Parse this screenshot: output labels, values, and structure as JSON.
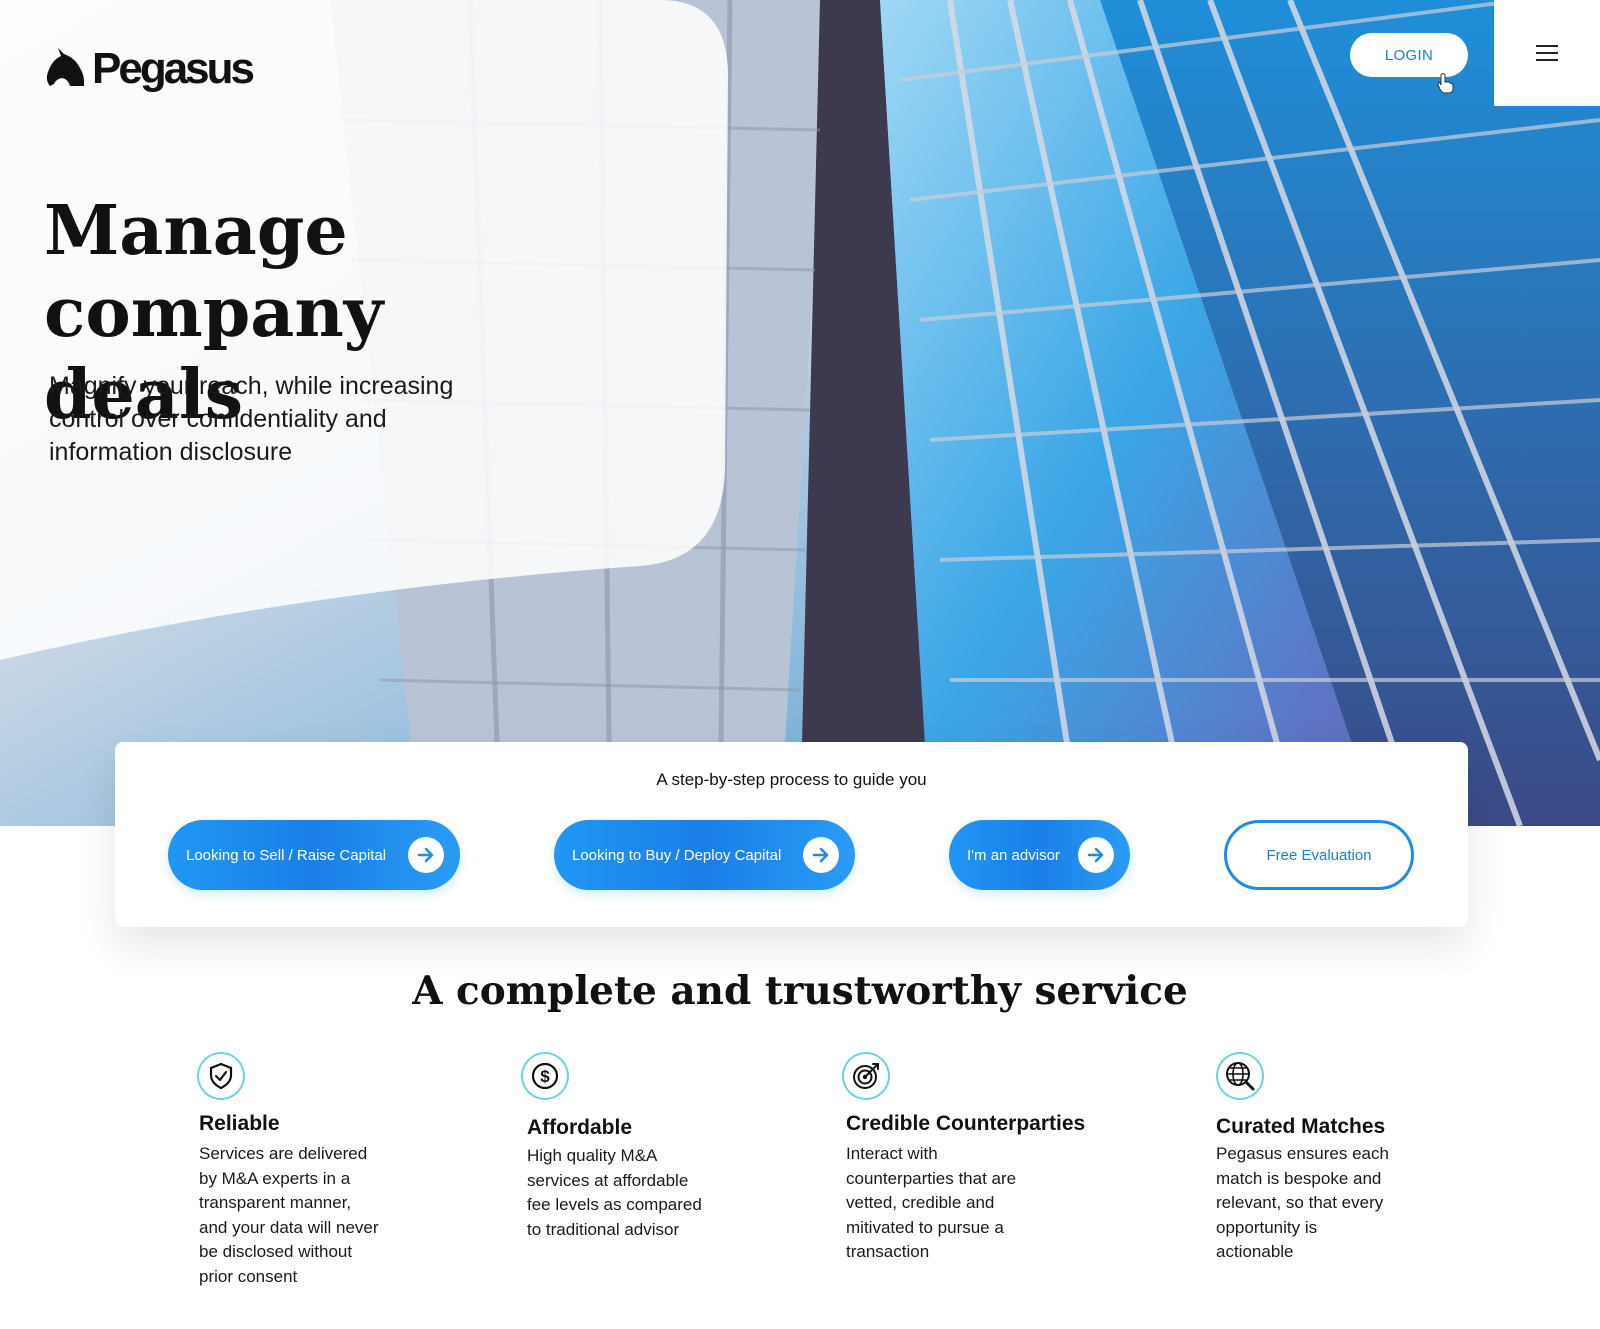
{
  "brand": {
    "name": "Pegasus"
  },
  "header": {
    "login_label": "LOGIN"
  },
  "hero": {
    "title_line1": "Manage",
    "title_line2": "company deals",
    "subtitle_line1": "Magnify your reach, while increasing",
    "subtitle_line2": "control over confidentiality and",
    "subtitle_line3": "information disclosure"
  },
  "process": {
    "title": "A step-by-step process to guide you",
    "buttons": [
      {
        "label": "Looking to Sell / Raise Capital"
      },
      {
        "label": "Looking to Buy / Deploy Capital"
      },
      {
        "label": "I'm an advisor"
      }
    ],
    "free_evaluation": "Free Evaluation"
  },
  "services": {
    "title": "A complete and trustworthy service",
    "items": [
      {
        "icon": "shield-check-icon",
        "heading": "Reliable",
        "lines": [
          "Services are delivered",
          "by M&A experts in a",
          "transparent manner,",
          "and your data will never",
          "be disclosed without",
          "prior consent"
        ]
      },
      {
        "icon": "dollar-icon",
        "heading": "Affordable",
        "lines": [
          "High quality M&A",
          "services at affordable",
          "fee levels as compared",
          "to traditional advisor"
        ]
      },
      {
        "icon": "target-icon",
        "heading": "Credible Counterparties",
        "lines": [
          "Interact with",
          "counterparties that are",
          "vetted, credible and",
          "mitivated to pursue a",
          "transaction"
        ]
      },
      {
        "icon": "globe-search-icon",
        "heading": "Curated Matches",
        "lines": [
          "Pegasus ensures each",
          "match is bespoke and",
          "relevant, so that every",
          "opportunity is",
          "actionable"
        ]
      }
    ]
  },
  "colors": {
    "accent": "#1e8be8",
    "icon_ring": "#6fd3d8"
  }
}
